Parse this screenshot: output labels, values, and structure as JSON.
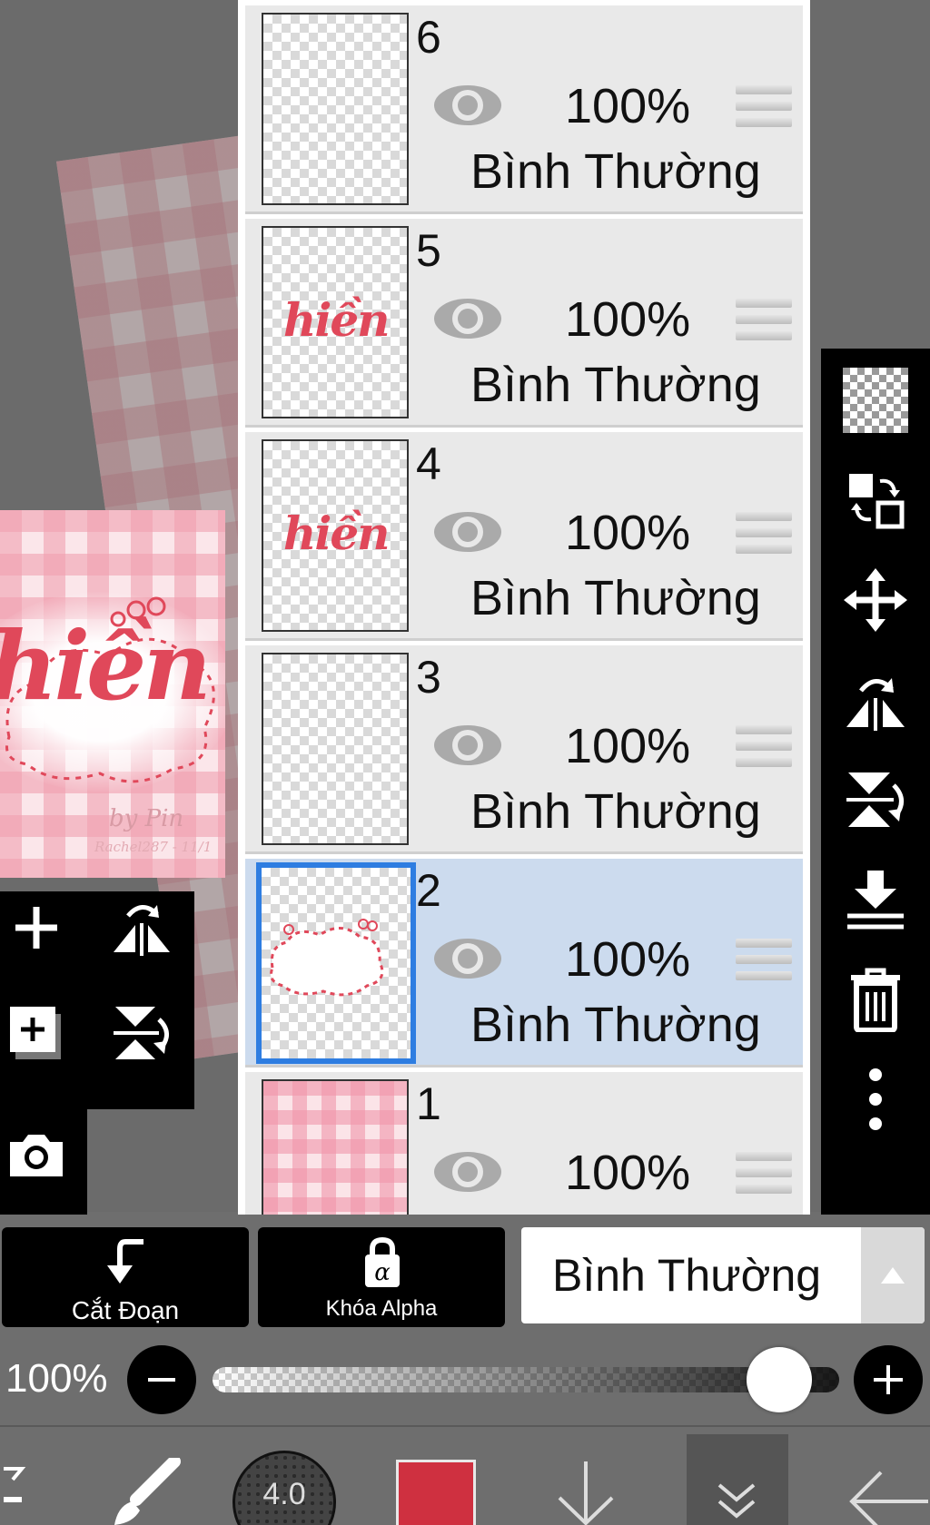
{
  "artwork": {
    "word": "hiền",
    "signature": "by Pin",
    "credit": "Rachel287 - 11/1"
  },
  "left_tools": {
    "add_layer": "add-icon",
    "flip_horizontal": "flip-horizontal-icon",
    "add_special_layer": "add-layer-icon",
    "flip_vertical": "flip-vertical-icon",
    "camera": "camera-icon"
  },
  "right_tools": [
    "transparency-icon",
    "layer-swap-icon",
    "move-icon",
    "flip-horizontal-icon",
    "flip-vertical-icon",
    "merge-down-icon",
    "delete-icon",
    "more-icon"
  ],
  "layers": [
    {
      "number": "6",
      "opacity": "100%",
      "blend": "Bình Thường",
      "content": "empty",
      "selected": false
    },
    {
      "number": "5",
      "opacity": "100%",
      "blend": "Bình Thường",
      "content": "text",
      "thumb_text": "hiền",
      "selected": false
    },
    {
      "number": "4",
      "opacity": "100%",
      "blend": "Bình Thường",
      "content": "text",
      "thumb_text": "hiền",
      "selected": false
    },
    {
      "number": "3",
      "opacity": "100%",
      "blend": "Bình Thường",
      "content": "empty",
      "selected": false
    },
    {
      "number": "2",
      "opacity": "100%",
      "blend": "Bình Thường",
      "content": "cloud",
      "selected": true
    },
    {
      "number": "1",
      "opacity": "100%",
      "blend": "",
      "content": "gingham",
      "selected": false
    }
  ],
  "controls": {
    "clipping_label": "Cắt Đoạn",
    "alpha_lock_label": "Khóa Alpha",
    "blend_mode": "Bình Thường",
    "opacity_value": "100%",
    "opacity_fraction": 1.0
  },
  "bottom_bar": {
    "brush_size": "4.0",
    "color": "#cf3040"
  },
  "colors": {
    "selection_border": "#2e7de1",
    "selected_row": "#ccdbee",
    "accent_red": "#e0485a"
  }
}
